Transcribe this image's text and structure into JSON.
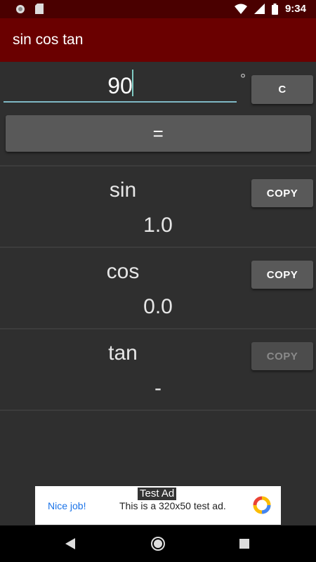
{
  "status_bar": {
    "time": "9:34"
  },
  "app": {
    "title": "sin cos tan"
  },
  "input": {
    "value": "90",
    "unit": "°",
    "clear_label": "C"
  },
  "equals_label": "=",
  "results": [
    {
      "label": "sin",
      "value": "1.0",
      "copy_label": "COPY",
      "copy_enabled": true
    },
    {
      "label": "cos",
      "value": "0.0",
      "copy_label": "COPY",
      "copy_enabled": true
    },
    {
      "label": "tan",
      "value": "-",
      "copy_label": "COPY",
      "copy_enabled": false
    }
  ],
  "ad": {
    "tag": "Test Ad",
    "headline": "Nice job!",
    "body": "This is a 320x50 test ad."
  },
  "colors": {
    "app_bar": "#6a0000",
    "status_bar": "#4a0000",
    "background": "#2f2f2f",
    "accent": "#80cbc4"
  }
}
